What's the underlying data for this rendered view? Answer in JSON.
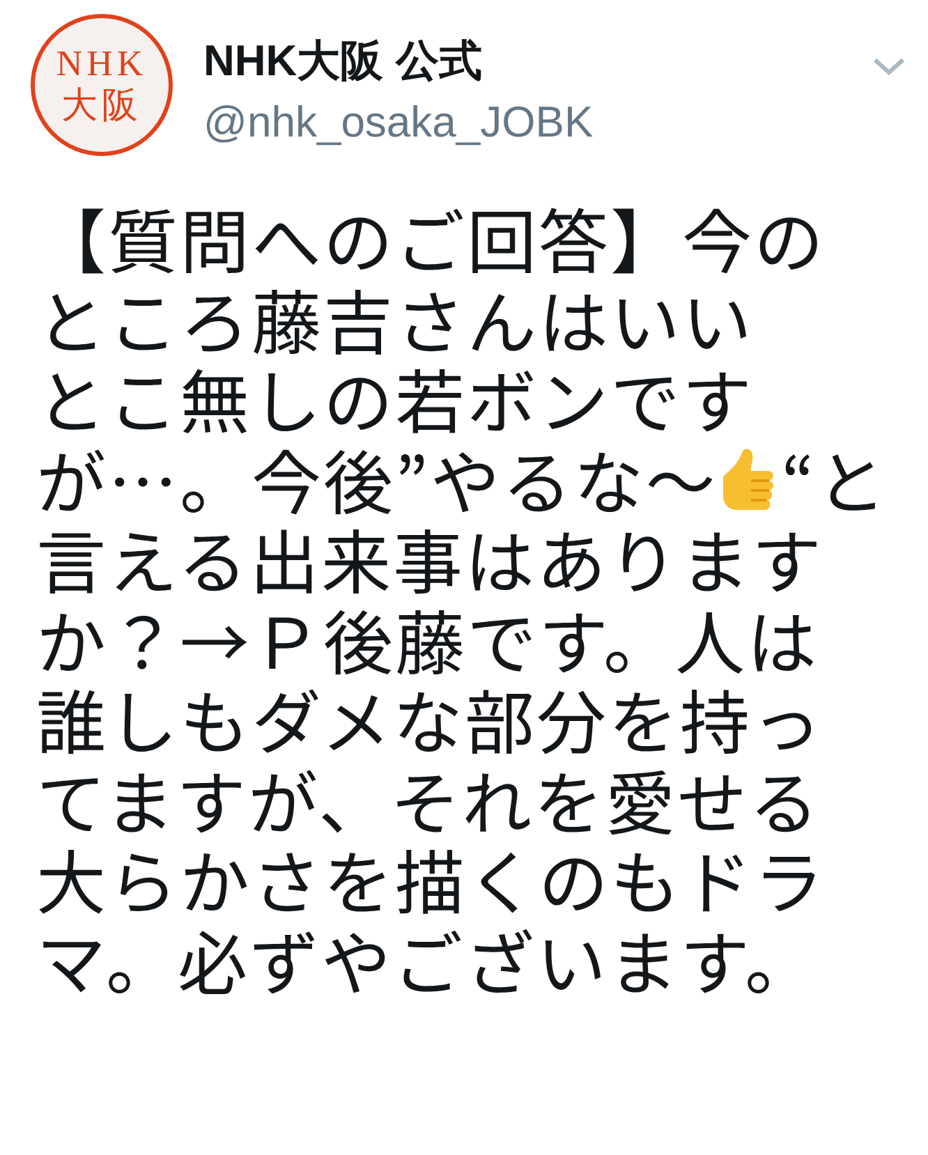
{
  "account": {
    "avatar_lines": [
      "NHK",
      "大阪"
    ],
    "name": "NHK大阪 公式",
    "handle": "@nhk_osaka_JOBK"
  },
  "lines": [
    {
      "kind": "text",
      "text": "【質問へのご回答】今の"
    },
    {
      "kind": "text",
      "text": "ところ藤吉さんはいい"
    },
    {
      "kind": "text",
      "text": "とこ無しの若ボンです"
    },
    {
      "kind": "emoji",
      "before": "が…。今後”やるな～",
      "after": "“と"
    },
    {
      "kind": "text",
      "text": "言える出来事はあります"
    },
    {
      "kind": "text",
      "text": "か？→Ｐ後藤です。人は"
    },
    {
      "kind": "text",
      "text": "誰しもダメな部分を持っ"
    },
    {
      "kind": "text",
      "text": "てますが、それを愛せる"
    },
    {
      "kind": "text",
      "text": "大らかさを描くのもドラ"
    },
    {
      "kind": "text",
      "text": "マ。必ずやございます。"
    }
  ]
}
